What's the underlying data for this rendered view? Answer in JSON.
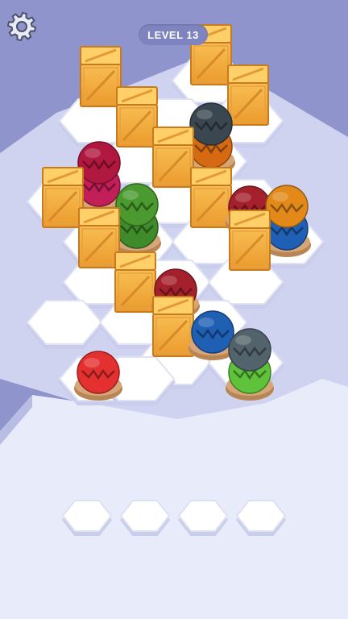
{
  "hud": {
    "level_label": "LEVEL 13",
    "settings_icon": "gear-icon"
  },
  "colors": {
    "background": "#8f95cc",
    "floor": "#e8ebf9",
    "tile": "#ffffff",
    "crate": "#f2a83a",
    "pedestal": "#d6a679"
  },
  "board": {
    "crates": [
      {
        "id": "c1"
      },
      {
        "id": "c2"
      },
      {
        "id": "c3"
      },
      {
        "id": "c4"
      },
      {
        "id": "c5"
      },
      {
        "id": "c6"
      },
      {
        "id": "c7"
      },
      {
        "id": "c8"
      },
      {
        "id": "c9"
      },
      {
        "id": "c10"
      },
      {
        "id": "c11"
      },
      {
        "id": "c12"
      },
      {
        "id": "c13"
      }
    ],
    "stacks": [
      {
        "id": "s1",
        "balls": [
          "#c21e57",
          "#b0183f"
        ]
      },
      {
        "id": "s2",
        "balls": [
          "#d66a12",
          "#3a4750"
        ]
      },
      {
        "id": "s3",
        "balls": [
          "#3f8a2b",
          "#4a9a30"
        ]
      },
      {
        "id": "s4",
        "balls": [
          "#a4202c"
        ]
      },
      {
        "id": "s5",
        "balls": [
          "#1f5fb4",
          "#e2891a"
        ]
      },
      {
        "id": "s6",
        "balls": [
          "#a4202c"
        ]
      },
      {
        "id": "s7",
        "balls": [
          "#1f5fb4"
        ]
      },
      {
        "id": "s8",
        "balls": [
          "#e53030"
        ]
      },
      {
        "id": "s9",
        "balls": [
          "#5ec23a",
          "#53636c"
        ]
      }
    ]
  },
  "tray": {
    "slots": [
      {
        "id": "slot-1"
      },
      {
        "id": "slot-2"
      },
      {
        "id": "slot-3"
      },
      {
        "id": "slot-4"
      }
    ]
  }
}
